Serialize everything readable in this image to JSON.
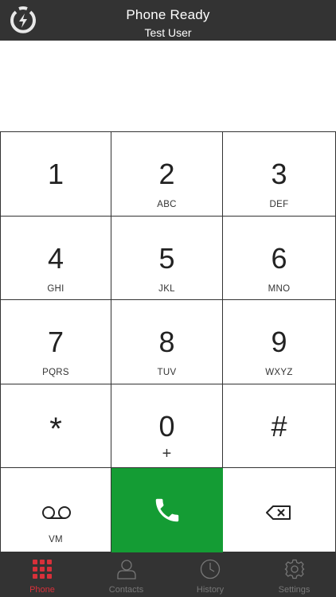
{
  "header": {
    "title": "Phone Ready",
    "subtitle": "Test User"
  },
  "display": {
    "number": ""
  },
  "keypad": [
    {
      "digit": "1",
      "letters": ""
    },
    {
      "digit": "2",
      "letters": "ABC"
    },
    {
      "digit": "3",
      "letters": "DEF"
    },
    {
      "digit": "4",
      "letters": "GHI"
    },
    {
      "digit": "5",
      "letters": "JKL"
    },
    {
      "digit": "6",
      "letters": "MNO"
    },
    {
      "digit": "7",
      "letters": "PQRS"
    },
    {
      "digit": "8",
      "letters": "TUV"
    },
    {
      "digit": "9",
      "letters": "WXYZ"
    }
  ],
  "bottom_row": {
    "star": "*",
    "zero": "0",
    "zero_sub": "+",
    "hash": "#"
  },
  "action_row": {
    "voicemail_label": "VM",
    "voicemail_icon": "voicemail-icon",
    "call_icon": "phone-icon",
    "delete_icon": "backspace-icon"
  },
  "tabs": [
    {
      "label": "Phone",
      "icon": "keypad-grid-icon",
      "active": true
    },
    {
      "label": "Contacts",
      "icon": "person-icon",
      "active": false
    },
    {
      "label": "History",
      "icon": "clock-icon",
      "active": false
    },
    {
      "label": "Settings",
      "icon": "gear-icon",
      "active": false
    }
  ],
  "colors": {
    "header_bg": "#333333",
    "call_green": "#149c34",
    "active_tab": "#d8303a",
    "inactive_tab": "#777777"
  }
}
